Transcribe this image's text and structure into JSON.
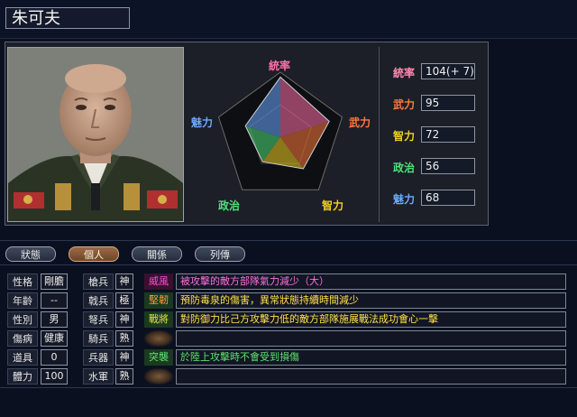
{
  "character": {
    "name": "朱可夫"
  },
  "radar": {
    "labels": {
      "lead": "統率",
      "war": "武力",
      "int": "智力",
      "pol": "政治",
      "cha": "魅力"
    },
    "values": {
      "lead": 111,
      "war": 95,
      "int": 72,
      "pol": 56,
      "cha": 68
    },
    "max": 120
  },
  "stats": [
    {
      "label": "統率",
      "value": "104(+ 7)",
      "color": "#ff8ab0"
    },
    {
      "label": "武力",
      "value": "95",
      "color": "#ff7a3a"
    },
    {
      "label": "智力",
      "value": "72",
      "color": "#f0d020"
    },
    {
      "label": "政治",
      "value": "56",
      "color": "#4fe07a"
    },
    {
      "label": "魅力",
      "value": "68",
      "color": "#6aa8ff"
    }
  ],
  "tabs": [
    {
      "label": "狀態",
      "active": false
    },
    {
      "label": "個人",
      "active": true
    },
    {
      "label": "關係",
      "active": false
    },
    {
      "label": "列傳",
      "active": false
    }
  ],
  "personal": [
    {
      "label": "性格",
      "value": "剛膽"
    },
    {
      "label": "年齡",
      "value": "--"
    },
    {
      "label": "性別",
      "value": "男"
    },
    {
      "label": "傷病",
      "value": "健康"
    },
    {
      "label": "道具",
      "value": "0"
    },
    {
      "label": "體力",
      "value": "100"
    }
  ],
  "arms": [
    {
      "label": "槍兵",
      "value": "神"
    },
    {
      "label": "戟兵",
      "value": "極"
    },
    {
      "label": "弩兵",
      "value": "神"
    },
    {
      "label": "騎兵",
      "value": "熟"
    },
    {
      "label": "兵器",
      "value": "神"
    },
    {
      "label": "水軍",
      "value": "熟"
    }
  ],
  "skills": [
    {
      "name": "威風",
      "desc": "被攻擊的敵方部隊氣力減少（大）",
      "color": "#ff4fd0"
    },
    {
      "name": "堅韌",
      "desc": "預防毒泉的傷害，異常狀態持續時間減少",
      "color": "#ff9a3a"
    },
    {
      "name": "戰將",
      "desc": "對防御力比己方攻擊力低的敵方部隊施展戰法成功會心一擊",
      "color": "#e0e040"
    },
    {
      "name": "",
      "desc": "",
      "color": ""
    },
    {
      "name": "突襲",
      "desc": "於陸上攻擊時不會受到損傷",
      "color": "#60e070"
    },
    {
      "name": "",
      "desc": "",
      "color": ""
    }
  ]
}
